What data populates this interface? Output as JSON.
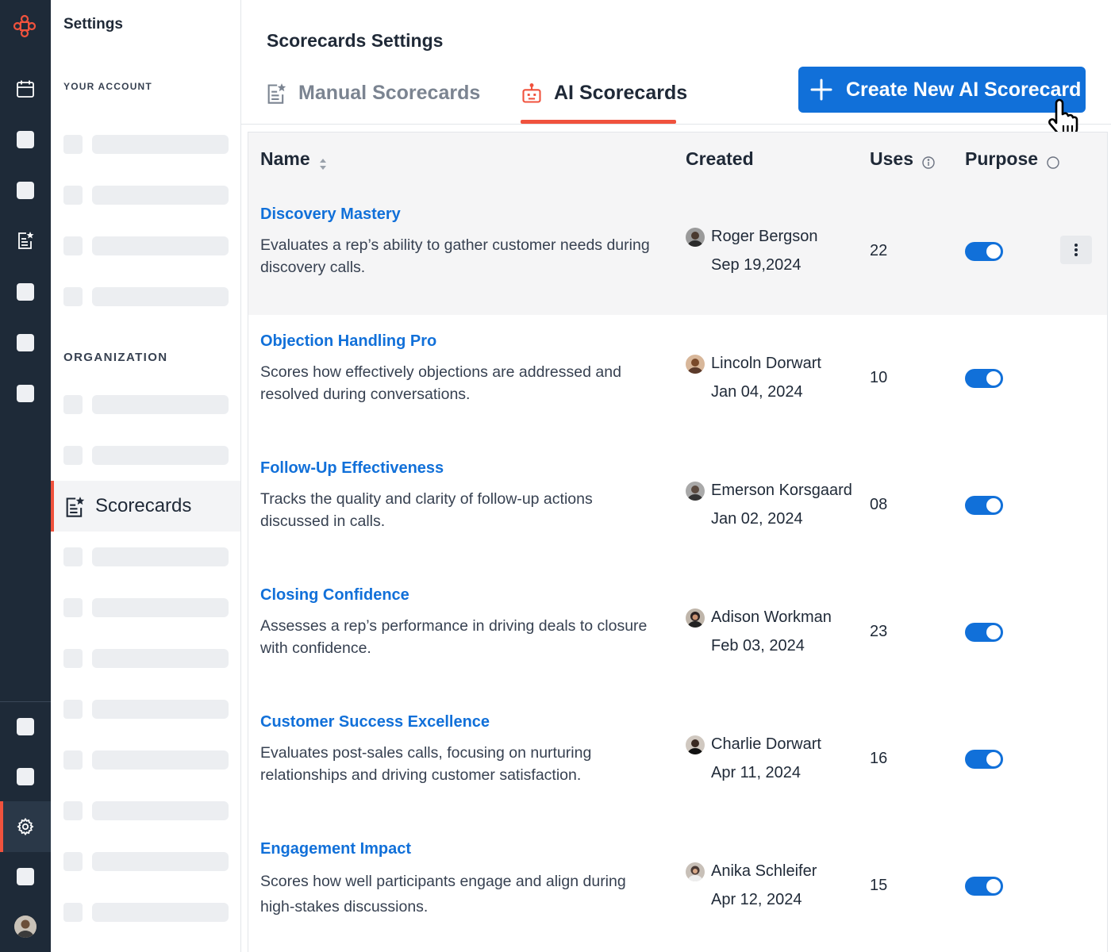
{
  "sidebar": {
    "title": "Settings",
    "section_account": "YOUR ACCOUNT",
    "section_org": "ORGANIZATION",
    "active_item": "Scorecards"
  },
  "main": {
    "page_title": "Scorecards Settings",
    "tabs": [
      {
        "label": "Manual Scorecards",
        "active": false
      },
      {
        "label": "AI Scorecards",
        "active": true
      }
    ],
    "create_button": "Create New AI Scorecard"
  },
  "table": {
    "columns": {
      "name": "Name",
      "created": "Created",
      "uses": "Uses",
      "purpose": "Purpose"
    },
    "rows": [
      {
        "name": "Discovery Mastery",
        "description": "Evaluates a rep’s ability to gather customer needs during discovery calls.",
        "creator": "Roger Bergson",
        "date": "Sep 19,2024",
        "uses": "22",
        "enabled": true
      },
      {
        "name": "Objection Handling Pro",
        "description": "Scores how effectively objections are addressed and resolved during conversations.",
        "creator": "Lincoln Dorwart",
        "date": "Jan 04, 2024",
        "uses": "10",
        "enabled": true
      },
      {
        "name": "Follow-Up Effectiveness",
        "description": "Tracks the quality and clarity of follow-up actions discussed in calls.",
        "creator": "Emerson Korsgaard",
        "date": "Jan 02, 2024",
        "uses": "08",
        "enabled": true
      },
      {
        "name": "Closing Confidence",
        "description": "Assesses a rep’s performance in driving deals to closure with confidence.",
        "creator": "Adison Workman",
        "date": "Feb 03, 2024",
        "uses": "23",
        "enabled": true
      },
      {
        "name": "Customer Success Excellence",
        "description": "Evaluates post-sales calls, focusing on nurturing relationships and driving customer satisfaction.",
        "creator": "Charlie Dorwart",
        "date": "Apr 11, 2024",
        "uses": "16",
        "enabled": true
      },
      {
        "name": "Engagement Impact",
        "description": "Scores how well participants engage and align during high-stakes discussions.",
        "creator": "Anika Schleifer",
        "date": "Apr 12, 2024",
        "uses": "15",
        "enabled": true
      }
    ]
  },
  "colors": {
    "rail_bg": "#1e2a38",
    "accent": "#f0523d",
    "primary": "#1170d9"
  },
  "icons": {
    "logo": "brand-logo-icon",
    "calendar": "calendar-icon",
    "scorecard": "scorecard-star-icon",
    "settings": "gear-icon",
    "robot": "robot-icon",
    "plus": "plus-icon",
    "more": "more-vertical-icon"
  }
}
